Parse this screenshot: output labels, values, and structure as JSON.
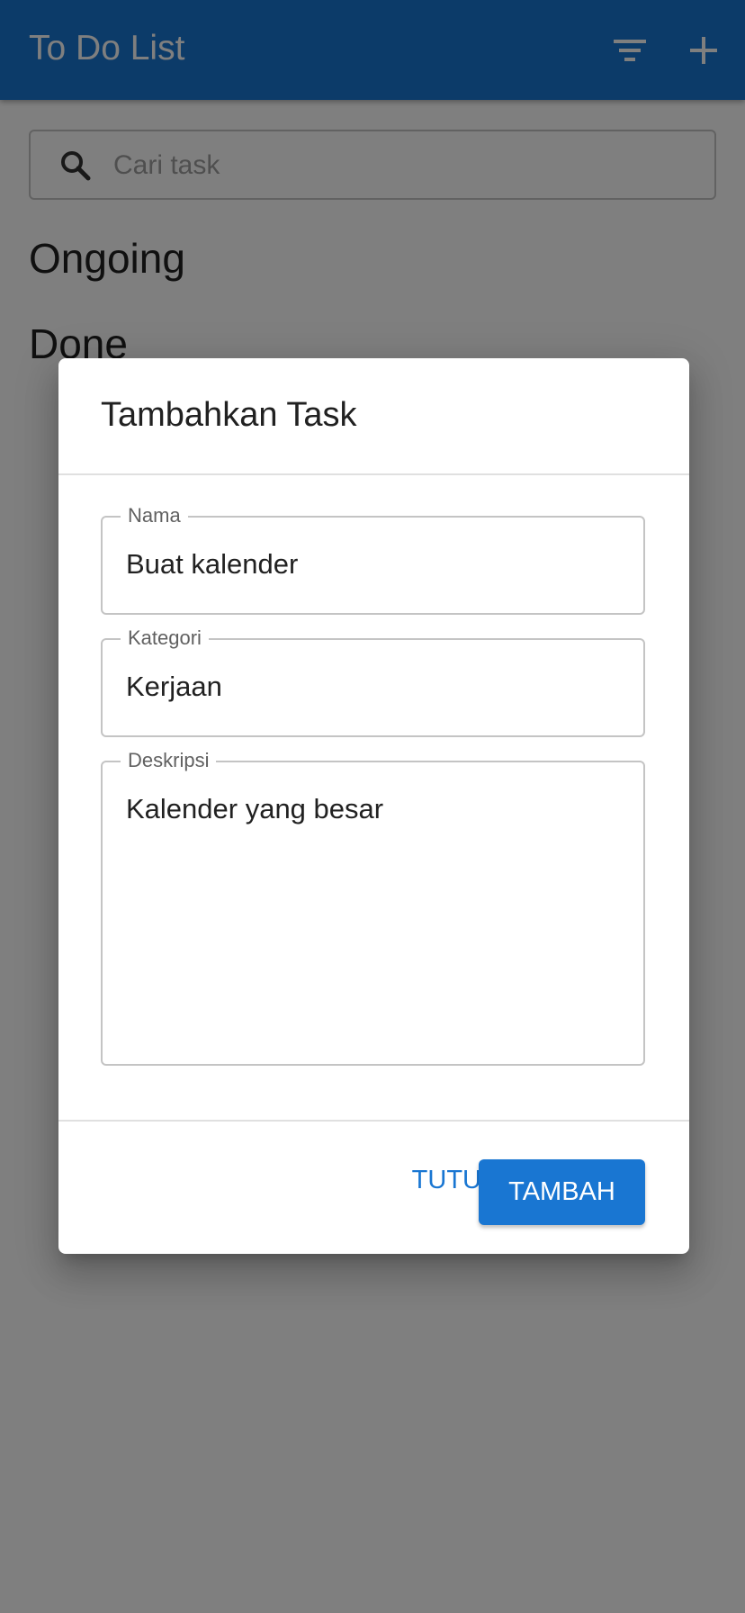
{
  "app": {
    "title": "To Do List"
  },
  "search": {
    "placeholder": "Cari task",
    "value": ""
  },
  "sections": {
    "ongoing": "Ongoing",
    "done": "Done"
  },
  "dialog": {
    "title": "Tambahkan Task",
    "fields": {
      "nama": {
        "label": "Nama",
        "value": "Buat kalender"
      },
      "kategori": {
        "label": "Kategori",
        "value": "Kerjaan"
      },
      "deskripsi": {
        "label": "Deskripsi",
        "value": "Kalender yang besar"
      }
    },
    "actions": {
      "close": "TUTUP",
      "add": "TAMBAH"
    }
  },
  "icons": {
    "filter": "filter-icon",
    "add": "add-icon",
    "search": "search-icon"
  },
  "colors": {
    "primary": "#1976d2",
    "backdrop": "rgba(0,0,0,0.5)"
  }
}
